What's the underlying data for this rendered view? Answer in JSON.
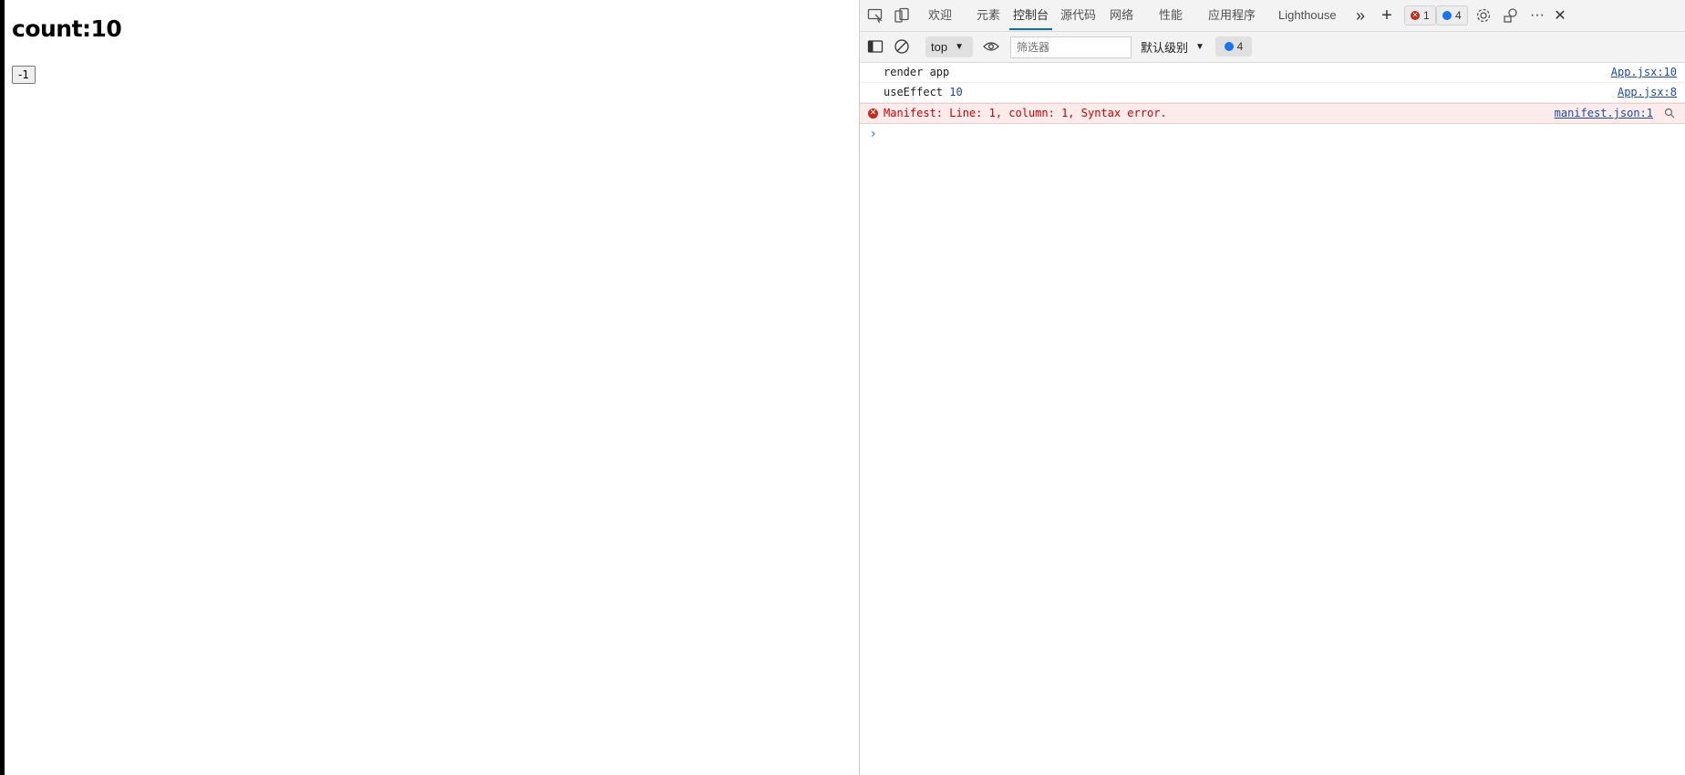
{
  "page": {
    "heading": "count:10",
    "decrement_label": "-1"
  },
  "devtools": {
    "tabs": [
      {
        "label": "欢迎"
      },
      {
        "label": "元素"
      },
      {
        "label": "控制台"
      },
      {
        "label": "源代码"
      },
      {
        "label": "网络"
      },
      {
        "label": "性能"
      },
      {
        "label": "应用程序"
      },
      {
        "label": "Lighthouse"
      }
    ],
    "active_tab": "控制台",
    "error_count": "1",
    "message_count": "4",
    "toolbar": {
      "context": "top",
      "filter_placeholder": "筛选器",
      "level": "默认级别",
      "issues_count": "4"
    },
    "console": [
      {
        "text": "render app",
        "source": "App.jsx:10"
      },
      {
        "text": "useEffect ",
        "value": "10",
        "source": "App.jsx:8"
      },
      {
        "text": "Manifest: Line: 1, column: 1, Syntax error.",
        "source": "manifest.json:1"
      }
    ],
    "prompt_glyph": "›"
  },
  "colors": {
    "accent": "#0f6cbd",
    "error_bg": "#fcebeb",
    "error_text": "#d20000"
  }
}
